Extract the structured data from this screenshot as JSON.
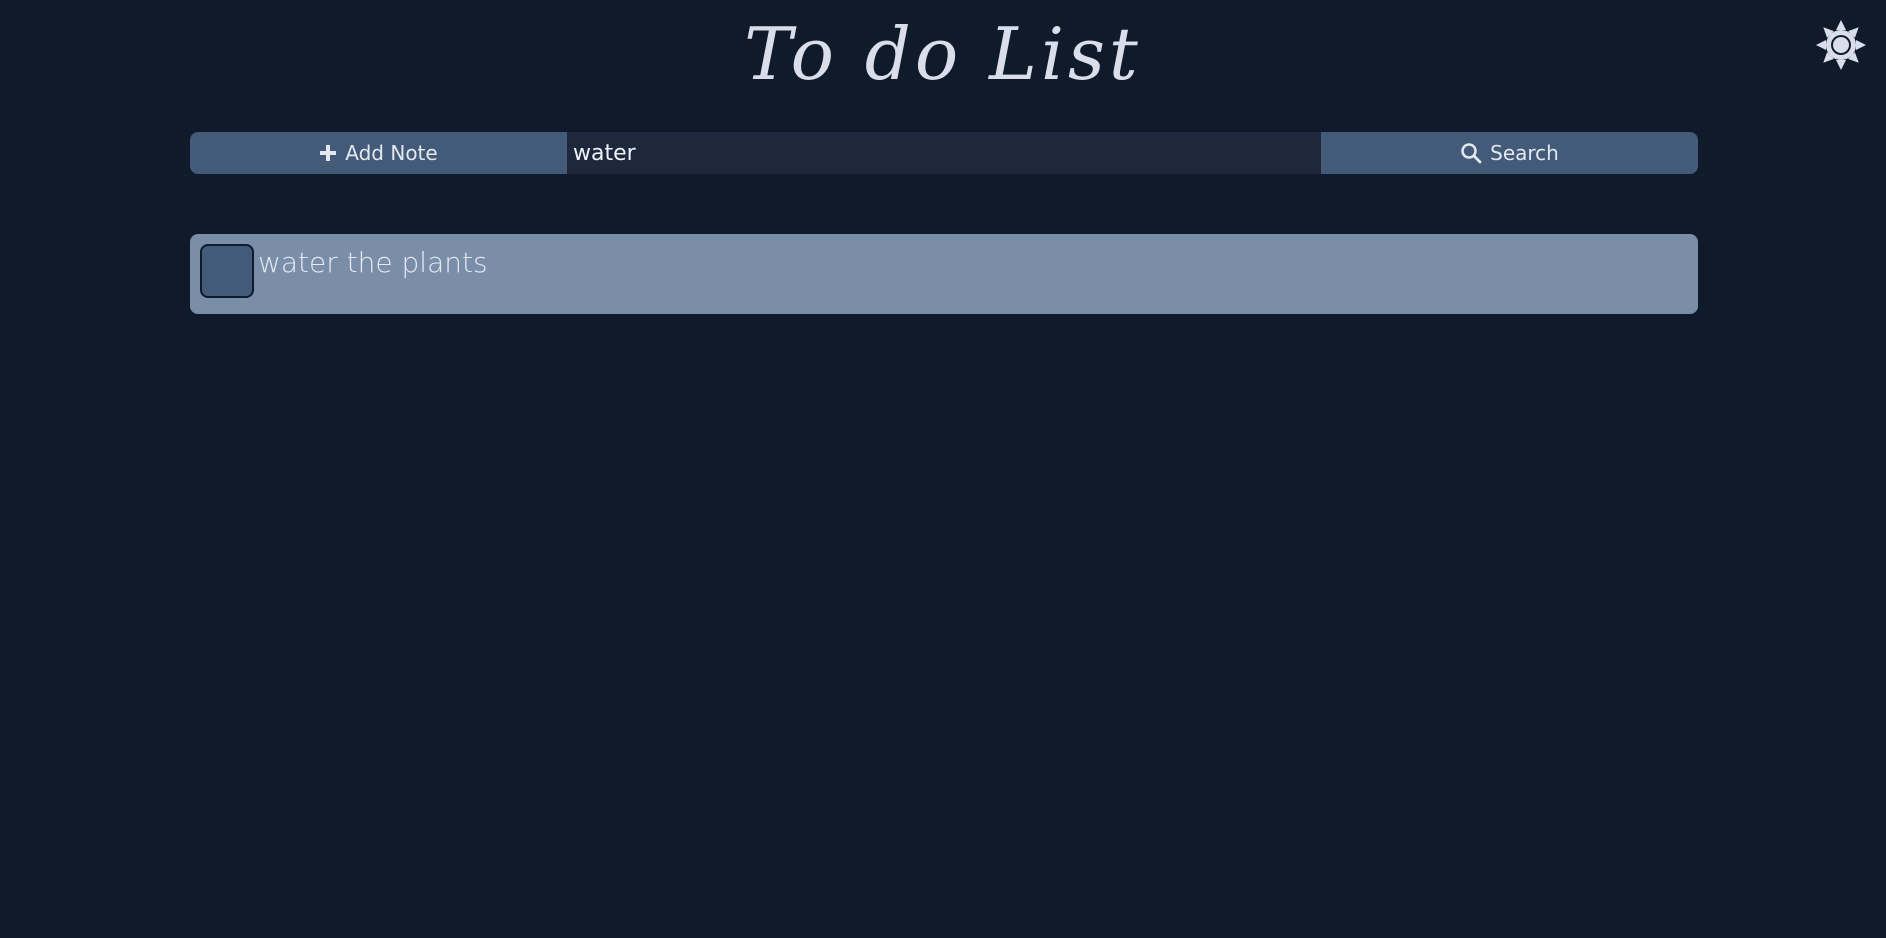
{
  "header": {
    "title": "To do List",
    "theme_toggle_icon": "sun-icon"
  },
  "toolbar": {
    "add_label": "Add Note",
    "add_icon": "plus-icon",
    "search_value": "water",
    "search_label": "Search",
    "search_icon": "search-icon"
  },
  "notes": [
    {
      "text": "water the plants",
      "checked": false
    }
  ],
  "colors": {
    "background": "#0f1b2a",
    "button": "#435a78",
    "input": "#1e283d",
    "note": "#7a8ea9",
    "text": "#d5dbe6"
  }
}
